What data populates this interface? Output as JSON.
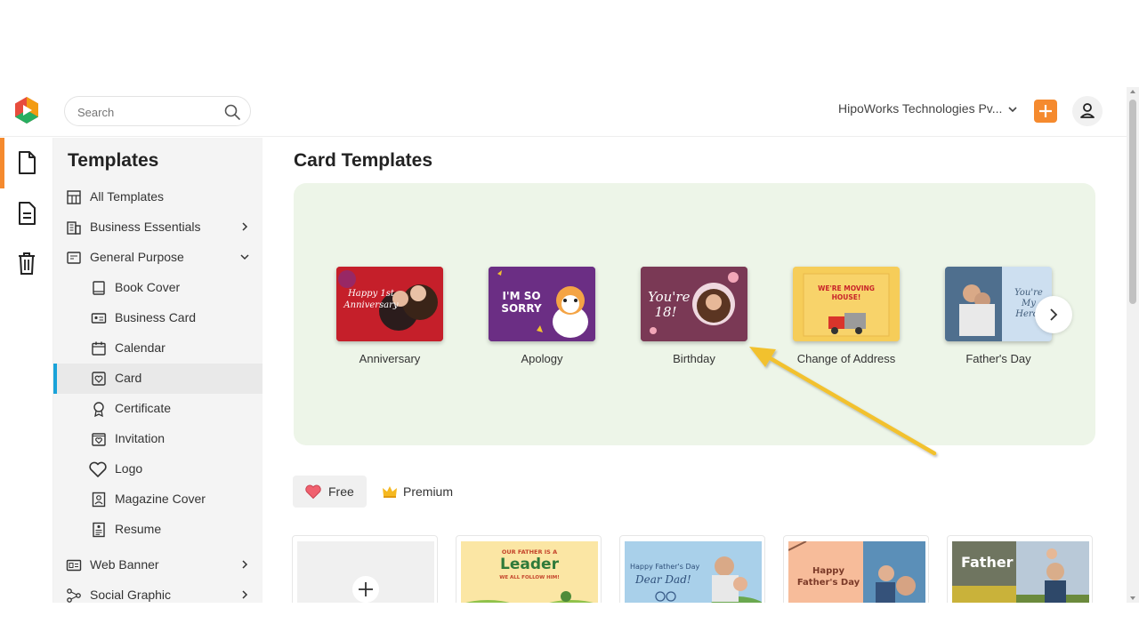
{
  "topbar": {
    "search_placeholder": "Search",
    "organization": "HipoWorks Technologies Pv...",
    "accent_color": "#f58a2e"
  },
  "rail": {
    "items": [
      {
        "icon": "document-icon",
        "active": true
      },
      {
        "icon": "form-icon",
        "active": false
      },
      {
        "icon": "trash-icon",
        "active": false
      }
    ]
  },
  "sidebar": {
    "title": "Templates",
    "items": [
      {
        "label": "All Templates",
        "icon": "grid-icon"
      },
      {
        "label": "Business Essentials",
        "icon": "building-icon",
        "expandable": true
      },
      {
        "label": "General Purpose",
        "icon": "list-icon",
        "expanded": true
      },
      {
        "label": "Book Cover",
        "icon": "book-icon"
      },
      {
        "label": "Business Card",
        "icon": "id-card-icon"
      },
      {
        "label": "Calendar",
        "icon": "calendar-icon"
      },
      {
        "label": "Card",
        "icon": "heart-card-icon",
        "active": true
      },
      {
        "label": "Certificate",
        "icon": "award-icon"
      },
      {
        "label": "Invitation",
        "icon": "envelope-heart-icon"
      },
      {
        "label": "Logo",
        "icon": "heart-icon"
      },
      {
        "label": "Magazine Cover",
        "icon": "person-frame-icon"
      },
      {
        "label": "Resume",
        "icon": "resume-icon"
      },
      {
        "label": "Web Banner",
        "icon": "banner-icon",
        "expandable": true
      },
      {
        "label": "Social Graphic",
        "icon": "share-icon",
        "expandable": true
      }
    ]
  },
  "main": {
    "title": "Card Templates",
    "categories": [
      {
        "label": "Anniversary",
        "art_text": "Happy 1st Anniversary"
      },
      {
        "label": "Apology",
        "art_text": "I'M SO SORRY"
      },
      {
        "label": "Birthday",
        "art_text": "You're 18!"
      },
      {
        "label": "Change of Address",
        "art_text": "WE'RE MOVING HOUSE!"
      },
      {
        "label": "Father's Day",
        "art_text": "You're My Hero!"
      }
    ],
    "filters": [
      {
        "label": "Free",
        "icon": "heart-icon",
        "selected": true
      },
      {
        "label": "Premium",
        "icon": "crown-icon",
        "selected": false
      }
    ],
    "template_cards": [
      {
        "type": "blank"
      },
      {
        "art_top": "OUR FATHER IS A",
        "art_main": "Leader",
        "art_sub": "WE ALL FOLLOW HIM!"
      },
      {
        "art_top": "Happy Father's Day",
        "art_main": "Dear Dad!"
      },
      {
        "art_top": "Happy",
        "art_main": "Father's Day"
      },
      {
        "art_main": "Father"
      }
    ]
  },
  "annotation": {
    "arrow_color": "#f2c12e"
  }
}
